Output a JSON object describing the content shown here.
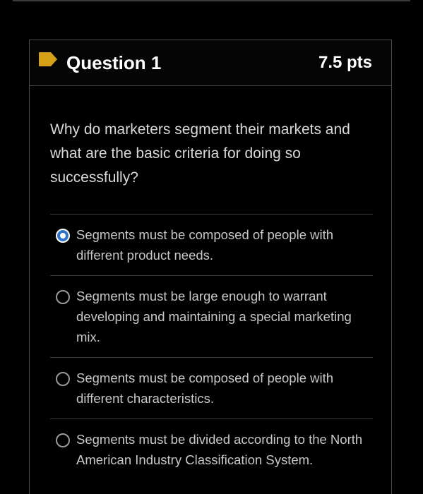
{
  "question": {
    "title": "Question 1",
    "points": "7.5 pts",
    "text": "Why do marketers segment their markets and what are the basic criteria for doing so successfully?",
    "flag_color": "#d4a017"
  },
  "answers": [
    {
      "label": "Segments must be composed of people with different product needs.",
      "selected": true
    },
    {
      "label": "Segments must be large enough to warrant developing and maintaining a special marketing mix.",
      "selected": false
    },
    {
      "label": "Segments must be composed of people with different characteristics.",
      "selected": false
    },
    {
      "label": "Segments must be divided according to the North American Industry Classification System.",
      "selected": false
    }
  ],
  "colors": {
    "selected_radio": "#2f73c8",
    "background": "#000000"
  }
}
